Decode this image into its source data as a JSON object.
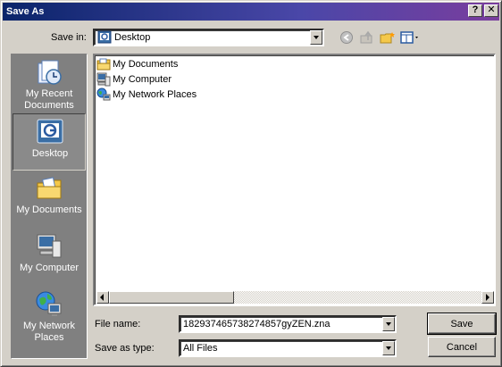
{
  "window": {
    "title": "Save As",
    "help_glyph": "?",
    "close_glyph": "✕"
  },
  "toolbar": {
    "save_in_label": "Save in:",
    "save_in_value": "Desktop",
    "icons": [
      "back-icon",
      "up-folder-icon",
      "new-folder-icon",
      "views-menu-icon"
    ]
  },
  "places": [
    {
      "label": "My Recent Documents",
      "icon": "recent-documents-icon"
    },
    {
      "label": "Desktop",
      "icon": "desktop-icon",
      "selected": true
    },
    {
      "label": "My Documents",
      "icon": "my-documents-icon"
    },
    {
      "label": "My Computer",
      "icon": "my-computer-icon"
    },
    {
      "label": "My Network Places",
      "icon": "network-places-icon"
    }
  ],
  "files": [
    {
      "name": "My Documents",
      "icon": "folder-icon"
    },
    {
      "name": "My Computer",
      "icon": "computer-icon"
    },
    {
      "name": "My Network Places",
      "icon": "network-icon"
    }
  ],
  "form": {
    "file_name_label": "File name:",
    "file_name_value": "182937465738274857gyZEN.zna",
    "save_as_type_label": "Save as type:",
    "save_as_type_value": "All Files"
  },
  "buttons": {
    "save": "Save",
    "cancel": "Cancel"
  },
  "colors": {
    "title_gradient_start": "#0a246a",
    "title_gradient_end": "#7a3d9e",
    "face": "#d4d0c8",
    "places_bar": "#808080"
  }
}
